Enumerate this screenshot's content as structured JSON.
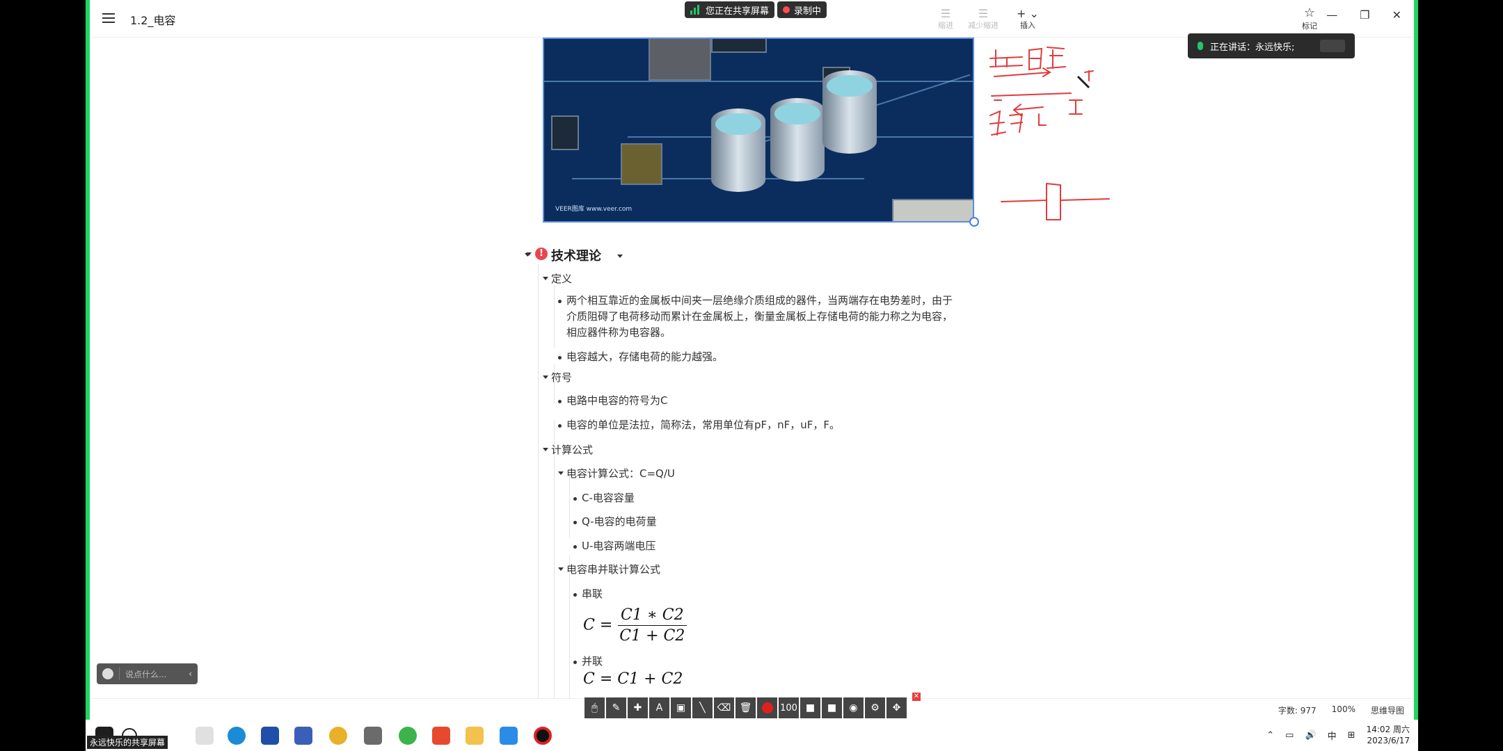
{
  "window": {
    "doc_title": "1.2_电容",
    "share_status": "您正在共享屏幕",
    "recording_status": "录制中",
    "toolbar": {
      "indent_label": "缩进",
      "outdent_label": "减少缩进",
      "insert_label": "插入",
      "favorite_label": "标记"
    },
    "speaking_label": "正在讲话：永远快乐;"
  },
  "image": {
    "watermark": "VEER图库 www.veer.com"
  },
  "outline": {
    "section_title": "技术理论",
    "definition": {
      "label": "定义",
      "items": [
        "两个相互靠近的金属板中间夹一层绝缘介质组成的器件，当两端存在电势差时，由于介质阻碍了电荷移动而累计在金属板上，衡量金属板上存储电荷的能力称之为电容，相应器件称为电容器。",
        "电容越大，存储电荷的能力越强。"
      ]
    },
    "symbol": {
      "label": "符号",
      "items": [
        "电路中电容的符号为C",
        "电容的单位是法拉，简称法，常用单位有pF，nF，uF，F。"
      ]
    },
    "formula": {
      "label": "计算公式",
      "capacitance": {
        "label": "电容计算公式：C=Q/U",
        "items": [
          "C-电容容量",
          "Q-电容的电荷量",
          "U-电容两端电压"
        ]
      },
      "series_parallel": {
        "label": "电容串并联计算公式",
        "series_label": "串联",
        "parallel_label": "并联"
      }
    }
  },
  "chat": {
    "placeholder": "说点什么..."
  },
  "status": {
    "word_count": "字数: 977",
    "zoom": "100%",
    "mindmap": "思维导图"
  },
  "annotation_toolbar": {
    "size_value": "100"
  },
  "taskbar": {
    "share_label": "永远快乐的共享屏幕",
    "ime": "中",
    "time": "14:02",
    "weekday": "周六",
    "date": "2023/6/17"
  }
}
